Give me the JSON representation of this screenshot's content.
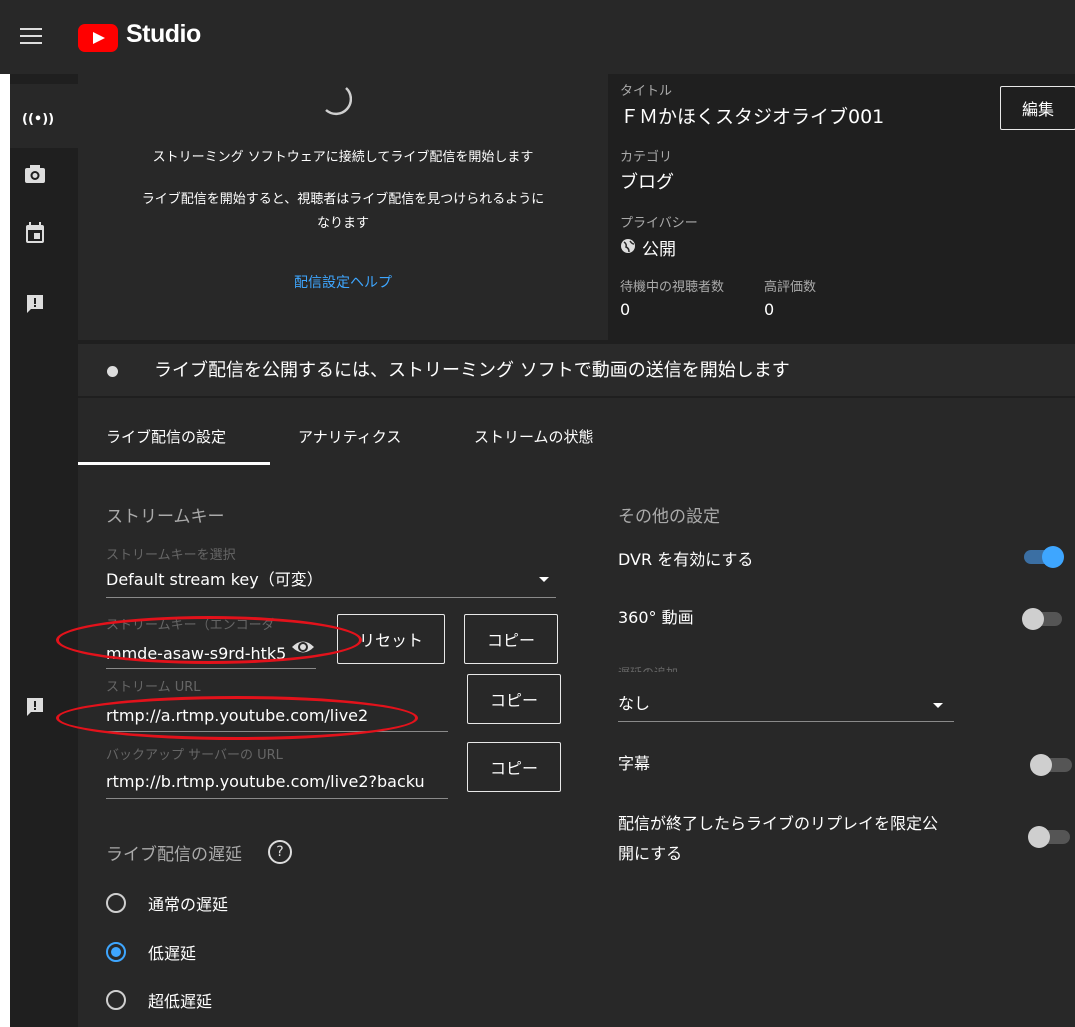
{
  "app": {
    "title": "Studio"
  },
  "preview": {
    "connect_text": "ストリーミング ソフトウェアに接続してライブ配信を開始します",
    "visible_text_1": "ライブ配信を開始すると、視聴者はライブ配信を見つけられるように",
    "visible_text_2": "なります",
    "help_link": "配信設定ヘルプ"
  },
  "info": {
    "title_label": "タイトル",
    "title_value": "ＦＭかほくスタジオライブ001",
    "edit_button": "編集",
    "category_label": "カテゴリ",
    "category_value": "ブログ",
    "privacy_label": "プライバシー",
    "privacy_value": "公開",
    "waiting_label": "待機中の視聴者数",
    "waiting_value": "0",
    "likes_label": "高評価数",
    "likes_value": "0"
  },
  "status_message": "ライブ配信を公開するには、ストリーミング ソフトで動画の送信を開始します",
  "tabs": [
    {
      "label": "ライブ配信の設定",
      "active": true
    },
    {
      "label": "アナリティクス",
      "active": false
    },
    {
      "label": "ストリームの状態",
      "active": false
    }
  ],
  "stream_key": {
    "heading": "ストリームキー",
    "select_label": "ストリームキーを選択",
    "select_value": "Default stream key（可変）",
    "encoder_label": "ストリームキー（エンコーダ",
    "encoder_value": "mmde-asaw-s9rd-htk5",
    "reset_button": "リセット",
    "copy_button": "コピー",
    "url_label": "ストリーム URL",
    "url_value": "rtmp://a.rtmp.youtube.com/live2",
    "backup_label": "バックアップ サーバーの URL",
    "backup_value": "rtmp://b.rtmp.youtube.com/live2?backu"
  },
  "latency": {
    "heading": "ライブ配信の遅延",
    "options": [
      {
        "label": "通常の遅延",
        "selected": false
      },
      {
        "label": "低遅延",
        "selected": true
      },
      {
        "label": "超低遅延",
        "selected": false
      }
    ]
  },
  "other": {
    "heading": "その他の設定",
    "dvr_label": "DVR を有効にする",
    "dvr_on": true,
    "video360_label": "360° 動画",
    "video360_on": false,
    "delay_label": "遅延の追加",
    "delay_value": "なし",
    "subtitles_label": "字幕",
    "subtitles_on": false,
    "replay_label_1": "配信が終了したらライブのリプレイを限定公",
    "replay_label_2": "開にする",
    "replay_on": false
  },
  "colors": {
    "accent": "#3ea6ff",
    "brand": "#ff0000",
    "annotation": "#e3121b"
  }
}
